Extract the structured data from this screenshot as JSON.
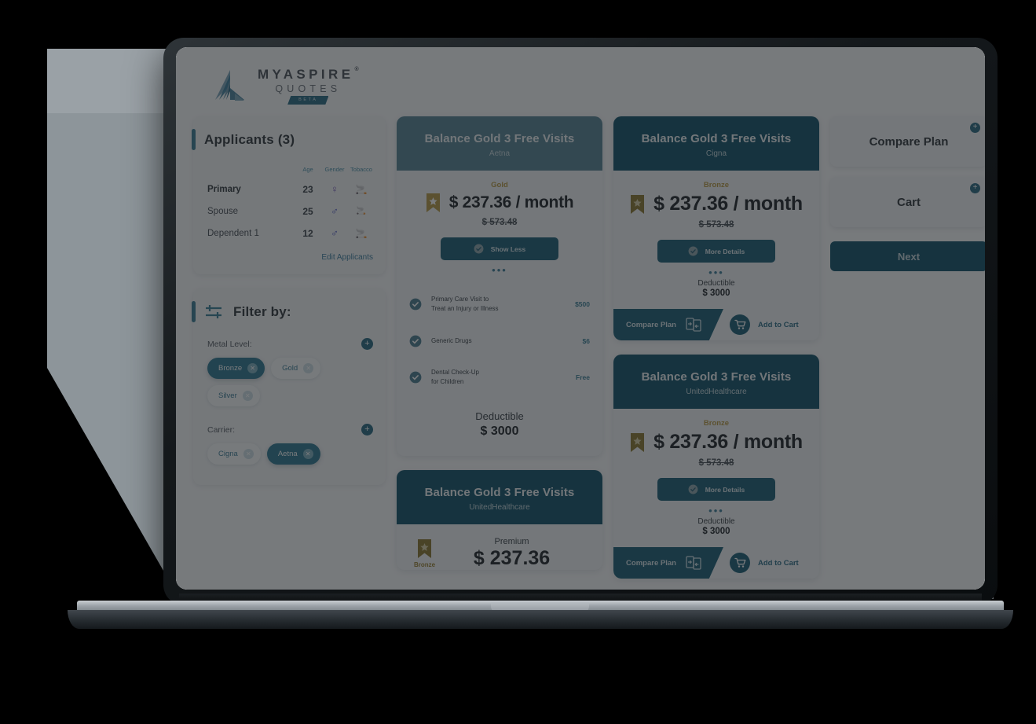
{
  "brand": {
    "line1": "MYASPIRE",
    "registered": "®",
    "line2": "QUOTES",
    "badge": "BETA",
    "logo_icon": "aspire-fan-logo"
  },
  "applicants": {
    "title": "Applicants (3)",
    "columns": [
      "Age",
      "Gender",
      "Tobacco"
    ],
    "rows": [
      {
        "name": "Primary",
        "age": "23",
        "gender": "female",
        "gender_glyph": "♀",
        "tobacco": "no",
        "tobacco_glyph": "🚭"
      },
      {
        "name": "Spouse",
        "age": "25",
        "gender": "male",
        "gender_glyph": "♂",
        "tobacco": "yes",
        "tobacco_glyph": "🚬"
      },
      {
        "name": "Dependent 1",
        "age": "12",
        "gender": "male",
        "gender_glyph": "♂",
        "tobacco": "no",
        "tobacco_glyph": "🚭"
      }
    ],
    "edit_link": "Edit Applicants"
  },
  "filter": {
    "title": "Filter by:",
    "icon": "filter-sliders-icon",
    "groups": [
      {
        "label": "Metal Level:",
        "add_label": "+",
        "chips": [
          {
            "label": "Bronze",
            "active": true
          },
          {
            "label": "Gold",
            "active": false
          },
          {
            "label": "Silver",
            "active": false
          }
        ]
      },
      {
        "label": "Carrier:",
        "add_label": "+",
        "chips": [
          {
            "label": "Cigna",
            "active": false
          },
          {
            "label": "Aetna",
            "active": true
          }
        ]
      }
    ]
  },
  "plans": {
    "expanded": {
      "title": "Balance Gold 3 Free Visits",
      "carrier": "Aetna",
      "metal": "Gold",
      "price": "$ 237.36 / month",
      "original_price": "$ 573.48",
      "toggle_label": "Show Less",
      "benefits": [
        {
          "name": "Primary Care Visit to\nTreat an Injury or Illness",
          "value": "$500"
        },
        {
          "name": "Generic Drugs",
          "value": "$6"
        },
        {
          "name": "Dental Check-Up\nfor Children",
          "value": "Free"
        }
      ],
      "deductible_label": "Deductible",
      "deductible_value": "$ 3000"
    },
    "premium_card": {
      "title": "Balance Gold 3 Free Visits",
      "carrier": "UnitedHealthcare",
      "metal": "Bronze",
      "premium_label": "Premium",
      "premium_value": "$ 237.36"
    },
    "collapsed": [
      {
        "title": "Balance Gold 3 Free Visits",
        "carrier": "Cigna",
        "metal": "Bronze",
        "price": "$ 237.36 / month",
        "original_price": "$ 573.48",
        "toggle_label": "More Details",
        "deductible_label": "Deductible",
        "deductible_value": "$ 3000",
        "compare_label": "Compare Plan",
        "cart_label": "Add to Cart"
      },
      {
        "title": "Balance Gold 3 Free Visits",
        "carrier": "UnitedHealthcare",
        "metal": "Bronze",
        "price": "$ 237.36 / month",
        "original_price": "$ 573.48",
        "toggle_label": "More Details",
        "deductible_label": "Deductible",
        "deductible_value": "$ 3000",
        "compare_label": "Compare Plan",
        "cart_label": "Add to Cart"
      }
    ]
  },
  "rail": {
    "compare_label": "Compare Plan",
    "cart_label": "Cart",
    "add_glyph": "+",
    "next_label": "Next"
  },
  "colors": {
    "brand_teal": "#2b6b83",
    "header_dark": "#14546b",
    "header_light": "#5a8596",
    "gold": "#b99b46",
    "link": "#3f7fa0",
    "page_bg": "#fbfcfd"
  }
}
